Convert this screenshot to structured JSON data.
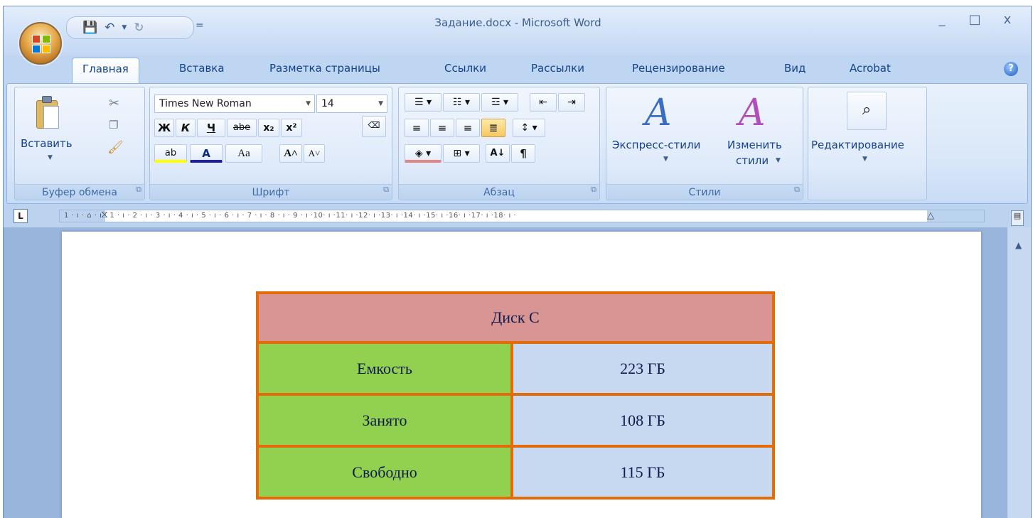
{
  "window": {
    "title": "Задание.docx - Microsoft Word",
    "controls": {
      "minimize": "_",
      "maximize": "□",
      "close": "x"
    }
  },
  "quick_access": {
    "save_icon": "save-icon",
    "undo_glyph": "↶",
    "redo_glyph": "↻",
    "menu_glyph": "="
  },
  "tabs": [
    {
      "label": "Главная",
      "active": true
    },
    {
      "label": "Вставка"
    },
    {
      "label": "Разметка страницы"
    },
    {
      "label": "Ссылки"
    },
    {
      "label": "Рассылки"
    },
    {
      "label": "Рецензирование"
    },
    {
      "label": "Вид"
    },
    {
      "label": "Acrobat"
    }
  ],
  "ribbon": {
    "clipboard": {
      "paste_label": "Вставить",
      "group_label": "Буфер обмена"
    },
    "font": {
      "font_name": "Times New Roman",
      "font_size": "14",
      "bold": "Ж",
      "italic": "К",
      "underline": "Ч",
      "strike": "abe",
      "subscript": "x₂",
      "superscript": "x²",
      "highlight": "ab",
      "font_color": "A",
      "change_case": "Aa",
      "grow": "A˄",
      "shrink": "A˅",
      "group_label": "Шрифт"
    },
    "paragraph": {
      "group_label": "Абзац",
      "pilcrow": "¶"
    },
    "styles": {
      "quick_styles": "Экспресс-стили",
      "change_styles": "Изменить",
      "change_styles_2": "стили",
      "group_label": "Стили"
    },
    "editing": {
      "label": "Редактирование"
    }
  },
  "ruler": {
    "text": "1 · ı · ⌂ · ı · 1 · ı · 2 · ı · 3 · ı · 4 · ı · 5 · ı · 6 · ı · 7 · ı · 8 · ı · 9 · ı ·10· ı ·11· ı ·12· ı ·13· ı ·14· ı ·15· ı ·16· ı ·17· ı ·18· ı ·"
  },
  "document": {
    "table": {
      "header": "Диск С",
      "rows": [
        {
          "label": "Емкость",
          "value": "223 ГБ"
        },
        {
          "label": "Занято",
          "value": "108 ГБ"
        },
        {
          "label": "Свободно",
          "value": "115 ГБ"
        }
      ]
    }
  },
  "colors": {
    "header_fill": "#d99594",
    "label_fill": "#92d050",
    "value_fill": "#c6d9f1",
    "border": "#e36c0a"
  }
}
